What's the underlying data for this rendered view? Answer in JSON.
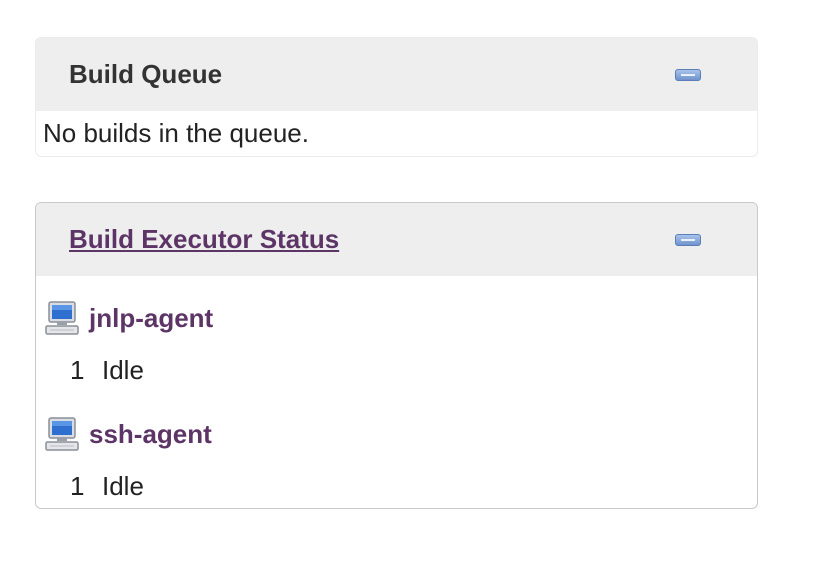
{
  "build_queue": {
    "title": "Build Queue",
    "empty_message": "No builds in the queue."
  },
  "executor_status": {
    "title": "Build Executor Status",
    "agents": [
      {
        "name": "jnlp-agent",
        "icon": "computer-icon",
        "executors": [
          {
            "number": "1",
            "status": "Idle"
          }
        ]
      },
      {
        "name": "ssh-agent",
        "icon": "computer-icon",
        "executors": [
          {
            "number": "1",
            "status": "Idle"
          }
        ]
      }
    ]
  },
  "colors": {
    "link": "#5c3566",
    "header_bg": "#eeeeee",
    "collapse_button": "#6f93cc"
  }
}
